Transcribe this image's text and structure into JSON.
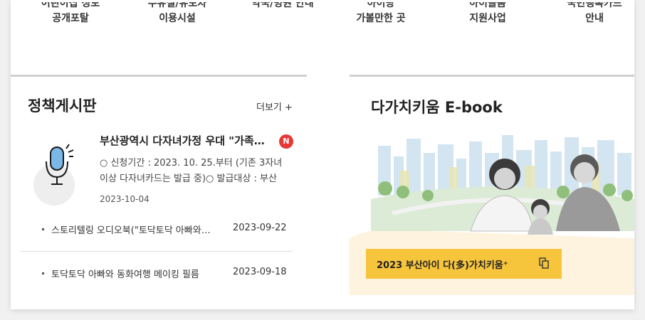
{
  "quick_links": [
    {
      "line1": "어린이집 정보",
      "line2": "공개포탈"
    },
    {
      "line1": "수유실/유모차",
      "line2": "이용시설"
    },
    {
      "line1": "약국/병원 안내",
      "line2": ""
    },
    {
      "line1": "아이랑",
      "line2": "가볼만한 곳"
    },
    {
      "line1": "아이돌봄",
      "line2": "지원사업"
    },
    {
      "line1": "국민행복카드",
      "line2": "안내"
    }
  ],
  "board": {
    "title": "정책게시판",
    "more_label": "더보기 +",
    "featured": {
      "title": "부산광역시 다자녀가정 우대 \"가족사랑카드\"",
      "badge": "N",
      "desc": "○ 신청기간 : 2023. 10. 25.부터 (기존 3자녀 이상 다자녀카드는 발급 중)○ 발급대상 : 부산",
      "date": "2023-10-04"
    },
    "items": [
      {
        "title": "스토리텔링 오디오북(\"토닥토닥 아빠와 동화여행\")",
        "date": "2023-09-22"
      },
      {
        "title": "토닥토닥 아빠와 동화여행 메이킹 필름",
        "date": "2023-09-18"
      }
    ]
  },
  "ebook": {
    "title": "다가치키움 E-book",
    "button_label": "2023 부산아이 다(多)가치키움⁺"
  },
  "colors": {
    "accent_yellow": "#f7c53b",
    "badge_red": "#e53935",
    "mic_blue": "#7ab8e8",
    "cream": "#fdf3df"
  }
}
